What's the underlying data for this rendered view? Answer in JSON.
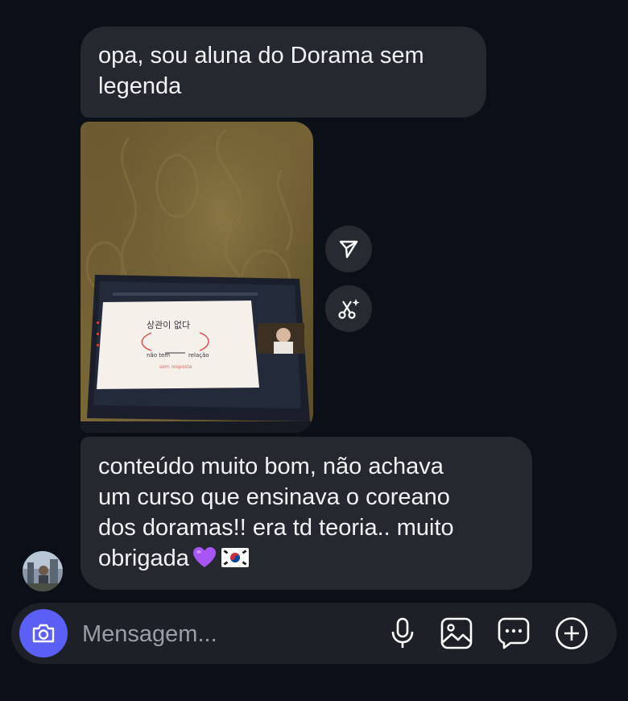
{
  "messages": [
    {
      "type": "text",
      "text": "opa, sou aluna do Dorama sem legenda"
    },
    {
      "type": "image",
      "board_text": {
        "korean": "상관이 없다",
        "left_note": "não tem",
        "right_note": "relação",
        "subnote": "sem resposta"
      }
    },
    {
      "type": "text",
      "lines": [
        "conteúdo muito bom, não achava",
        "um curso que ensinava o coreano",
        "dos doramas!! era td teoria.. muito",
        "obrigada"
      ],
      "emojis": [
        "purple-heart",
        "south-korea-flag"
      ]
    }
  ],
  "image_actions": [
    "share-icon",
    "ai-edit-icon"
  ],
  "composer": {
    "placeholder": "Mensagem...",
    "icons": [
      "camera-icon",
      "microphone-icon",
      "gallery-icon",
      "sticker-icon",
      "plus-icon"
    ]
  },
  "colors": {
    "background": "#0b0f18",
    "bubble": "#25282f",
    "text": "#f1f2f4",
    "accent": "#5b5ff6",
    "placeholder": "#9a9ea8"
  }
}
